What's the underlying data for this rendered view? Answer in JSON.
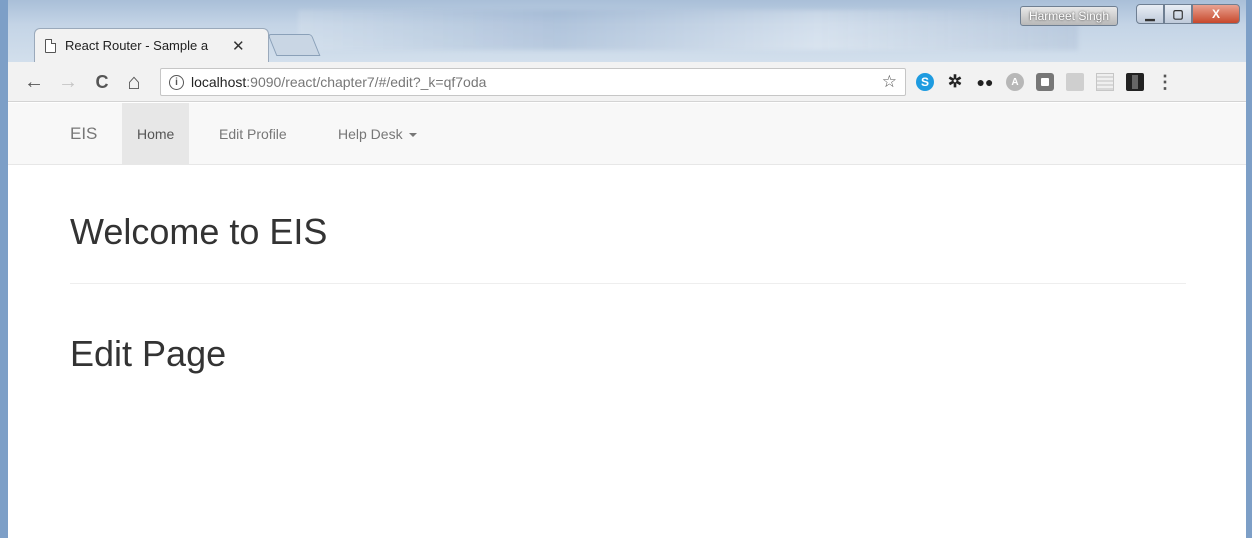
{
  "browser": {
    "tab": {
      "title": "React Router - Sample a",
      "close_glyph": "✕"
    },
    "user_badge": "Harmeet Singh",
    "window_controls": {
      "minimize": "▁",
      "maximize": "▢",
      "close": "X"
    },
    "nav": {
      "back": "←",
      "forward": "→",
      "reload": "C",
      "home": "⌂"
    },
    "address": {
      "info_glyph": "i",
      "host": "localhost",
      "path": ":9090/react/chapter7/#/edit?_k=qf7oda"
    },
    "star_glyph": "☆",
    "extensions": [
      "skype-icon",
      "gear-icon",
      "mask-icon",
      "angular-icon",
      "square-icon",
      "trello-icon",
      "grid-icon",
      "film-icon"
    ],
    "menu_glyph": "⋮"
  },
  "app": {
    "brand": "EIS",
    "nav_items": [
      {
        "label": "Home",
        "active": true
      },
      {
        "label": "Edit Profile",
        "active": false
      },
      {
        "label": "Help Desk",
        "active": false,
        "dropdown": true
      }
    ],
    "heading": "Welcome to EIS",
    "subheading": "Edit Page"
  },
  "colors": {
    "window_border": "#7d9fc7",
    "navbar_bg": "#f8f8f8",
    "nav_active_bg": "#e7e7e7",
    "text": "#333333",
    "nav_text": "#777777"
  }
}
